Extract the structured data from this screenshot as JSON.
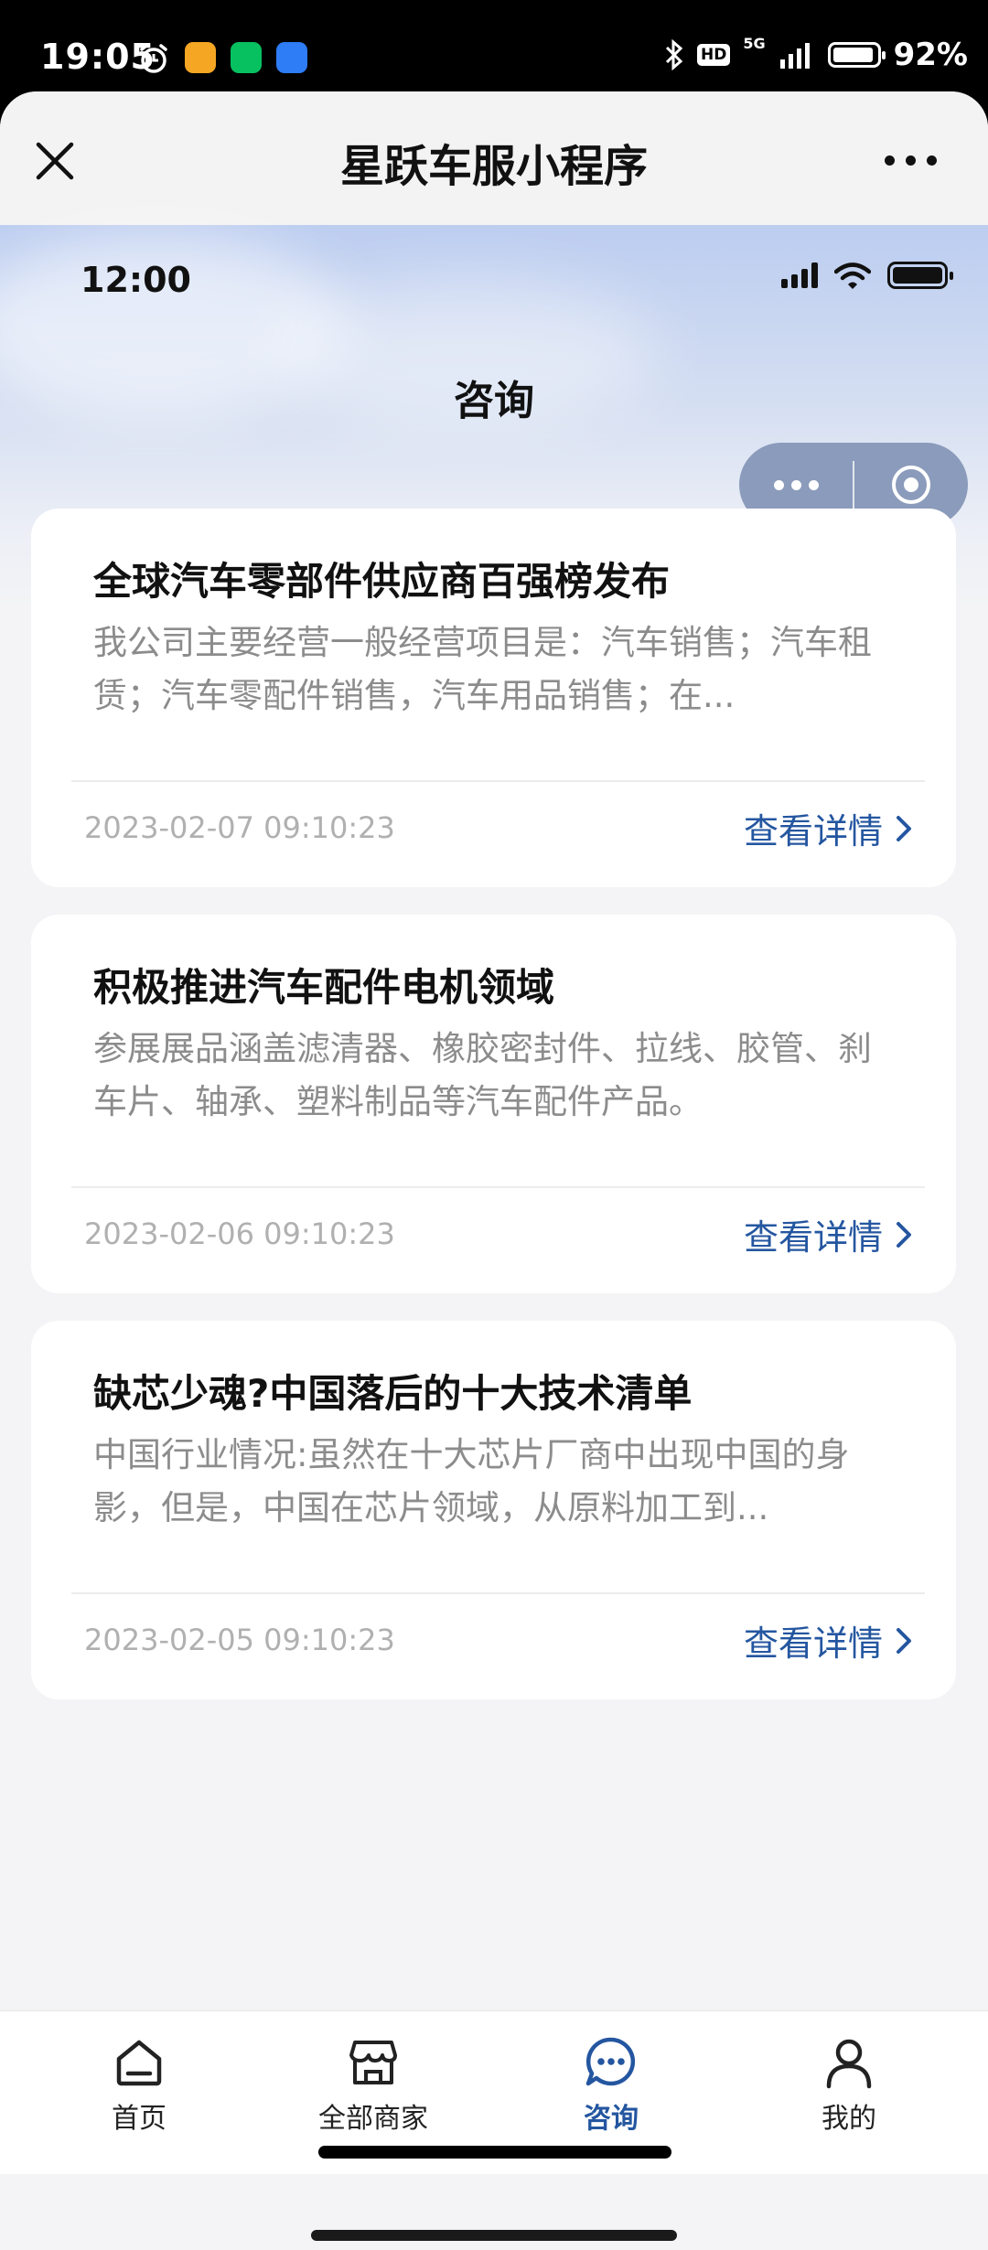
{
  "system_status": {
    "time": "19:05",
    "hd": "HD",
    "network": "5G",
    "battery": "92%",
    "app_icon_colors": [
      "#f5a623",
      "#07c160",
      "#2e7cf6"
    ]
  },
  "miniprogram": {
    "title": "星跃车服小程序"
  },
  "inner_status": {
    "time": "12:00"
  },
  "page": {
    "title": "咨询"
  },
  "articles": [
    {
      "title": "全球汽车零部件供应商百强榜发布",
      "summary": "我公司主要经营一般经营项目是：汽车销售；汽车租赁；汽车零配件销售，汽车用品销售；在...",
      "date": "2023-02-07 09:10:23",
      "link": "查看详情"
    },
    {
      "title": "积极推进汽车配件电机领域",
      "summary": "参展展品涵盖滤清器、橡胶密封件、拉线、胶管、刹车片、轴承、塑料制品等汽车配件产品。",
      "date": "2023-02-06 09:10:23",
      "link": "查看详情"
    },
    {
      "title": "缺芯少魂?中国落后的十大技术清单",
      "summary": "中国行业情况:虽然在十大芯片厂商中出现中国的身影，但是，中国在芯片领域，从原料加工到...",
      "date": "2023-02-05 09:10:23",
      "link": "查看详情"
    }
  ],
  "tabbar": {
    "items": [
      {
        "label": "首页",
        "icon": "home-icon",
        "active": false
      },
      {
        "label": "全部商家",
        "icon": "store-icon",
        "active": false
      },
      {
        "label": "咨询",
        "icon": "chat-icon",
        "active": true
      },
      {
        "label": "我的",
        "icon": "user-icon",
        "active": false
      }
    ]
  },
  "colors": {
    "accent": "#2456a0",
    "capsule": "#8b9bbb",
    "page_background": "#f4f4f6"
  }
}
